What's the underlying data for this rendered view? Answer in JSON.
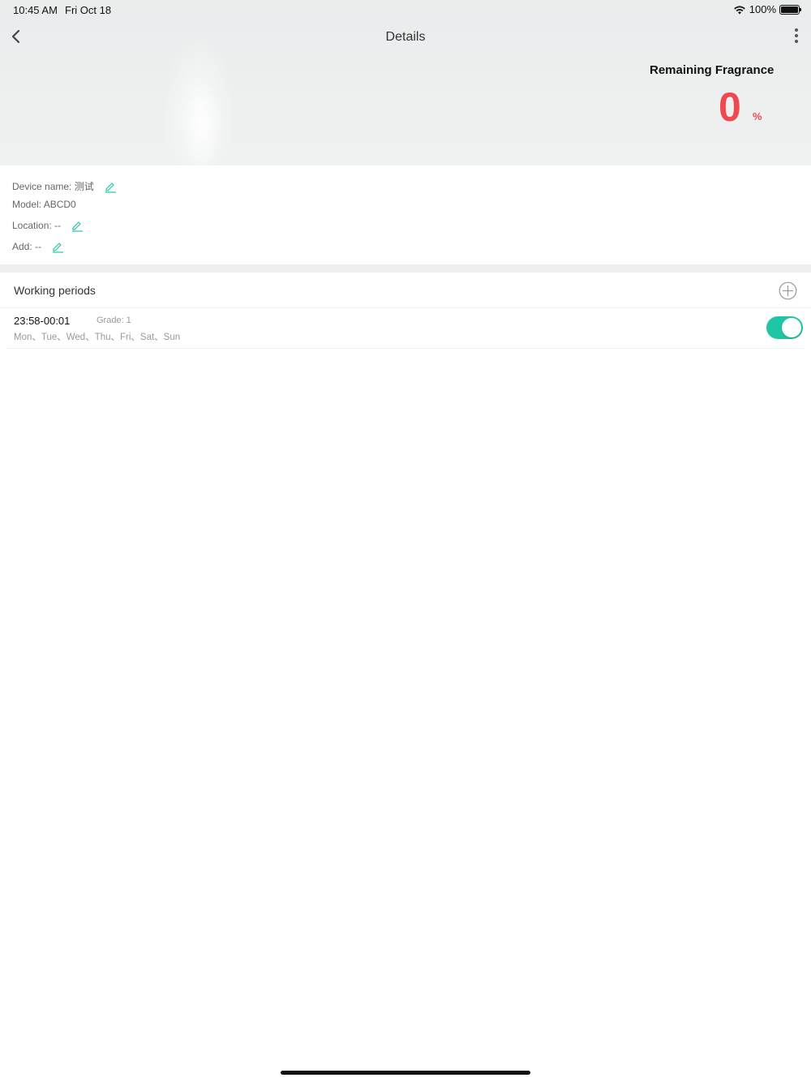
{
  "status_bar": {
    "time": "10:45 AM",
    "date": "Fri Oct 18",
    "battery": "100%"
  },
  "nav": {
    "title": "Details"
  },
  "fragrance": {
    "label": "Remaining Fragrance",
    "value": "0",
    "unit": "%"
  },
  "device": {
    "name_label": "Device name: 测试",
    "model_label": "Model: ABCD0",
    "location_label": "Location: --",
    "add_label": "Add: --"
  },
  "periods": {
    "title": "Working periods",
    "items": [
      {
        "time": "23:58-00:01",
        "grade": "Grade: 1",
        "days": "Mon、Tue、Wed、Thu、Fri、Sat、Sun",
        "enabled": true
      }
    ]
  },
  "colors": {
    "accent": "#1ec6a5",
    "fragrance": "#f0484e"
  }
}
